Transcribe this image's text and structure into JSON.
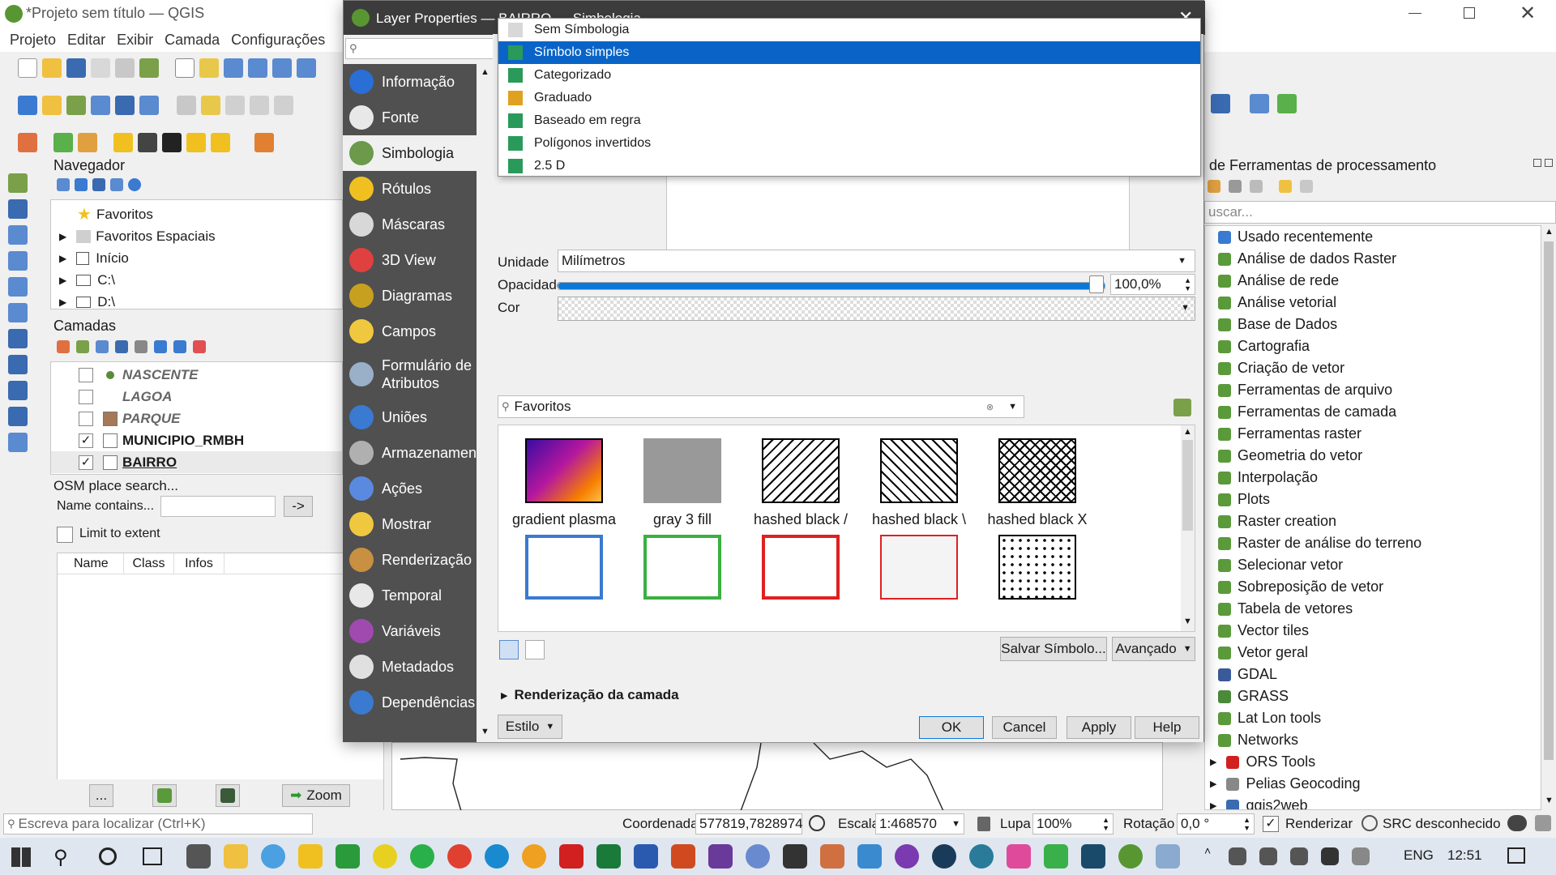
{
  "app": {
    "title": "*Projeto sem título — QGIS"
  },
  "menu": [
    "Projeto",
    "Editar",
    "Exibir",
    "Camada",
    "Configurações"
  ],
  "browser": {
    "title": "Navegador",
    "items": [
      {
        "label": "Favoritos"
      },
      {
        "label": "Favoritos Espaciais"
      },
      {
        "label": "Início"
      },
      {
        "label": "C:\\"
      },
      {
        "label": "D:\\"
      }
    ]
  },
  "layers": {
    "title": "Camadas",
    "items": [
      {
        "name": "NASCENTE",
        "checked": false,
        "bold": false,
        "italic": true,
        "swatch": "#5a8a3a"
      },
      {
        "name": "LAGOA",
        "checked": false,
        "bold": false,
        "italic": true,
        "swatch": "#ffffff"
      },
      {
        "name": "PARQUE",
        "checked": false,
        "bold": false,
        "italic": true,
        "swatch": "#a57858"
      },
      {
        "name": "MUNICIPIO_RMBH",
        "checked": true,
        "bold": true,
        "italic": false,
        "swatch": "#ffffff"
      },
      {
        "name": "BAIRRO",
        "checked": true,
        "bold": true,
        "italic": false,
        "swatch": "#ffffff",
        "underline": true
      }
    ]
  },
  "osm": {
    "title": "OSM place search...",
    "name_label": "Name contains...",
    "go": "->",
    "limit": "Limit to extent",
    "columns": [
      "Name",
      "Class",
      "Infos"
    ],
    "zoom": "Zoom",
    "dots": "..."
  },
  "dialog": {
    "title": "Layer Properties — BAIRRO — Simbologia",
    "sidebar": [
      "Informação",
      "Fonte",
      "Simbologia",
      "Rótulos",
      "Máscaras",
      "3D View",
      "Diagramas",
      "Campos",
      "Formulário de Atributos",
      "Uniões",
      "Armazenamento",
      "Ações",
      "Mostrar",
      "Renderização",
      "Temporal",
      "Variáveis",
      "Metadados",
      "Dependências"
    ],
    "sidebar_colors": [
      "#2a6fd6",
      "#e8e8e8",
      "#6a9a4a",
      "#f0c020",
      "#d8d8d8",
      "#e04040",
      "#c8a020",
      "#f0c840",
      "#9ab0c8",
      "#3a7ad0",
      "#b0b0b0",
      "#5a8ae0",
      "#f0c840",
      "#c89040",
      "#e8e8e8",
      "#a04ab0",
      "#e0e0e0",
      "#3a7ad0"
    ],
    "selected": "Simbologia",
    "dropdown": [
      {
        "label": "Sem Símbologia",
        "color": "#d8d8d8"
      },
      {
        "label": "Símbolo simples",
        "color": "#2a9a5a"
      },
      {
        "label": "Categorizado",
        "color": "#2a9a5a"
      },
      {
        "label": "Graduado",
        "color": "#e0a020"
      },
      {
        "label": "Baseado em regra",
        "color": "#2a9a5a"
      },
      {
        "label": "Polígonos invertidos",
        "color": "#2a9a5a"
      },
      {
        "label": "2.5 D",
        "color": "#2a9a5a"
      }
    ],
    "dropdown_selected": "Símbolo simples",
    "unit_label": "Unidade",
    "unit_value": "Milímetros",
    "opacity_label": "Opacidade",
    "opacity_value": "100,0%",
    "opacity_fill": 1.0,
    "color_label": "Cor",
    "search_value": "Favoritos",
    "symbols": [
      {
        "label": "gradient plasma"
      },
      {
        "label": "gray 3 fill"
      },
      {
        "label": "hashed black /"
      },
      {
        "label": "hashed black \\"
      },
      {
        "label": "hashed black X"
      }
    ],
    "save_symbol": "Salvar Símbolo...",
    "advanced": "Avançado",
    "rendering": "Renderização da camada",
    "style": "Estilo",
    "ok": "OK",
    "cancel": "Cancel",
    "apply": "Apply",
    "help": "Help"
  },
  "processing": {
    "title": "de Ferramentas de processamento",
    "search_placeholder": "uscar...",
    "items": [
      "Usado recentemente",
      "Análise de dados Raster",
      "Análise de rede",
      "Análise vetorial",
      "Base de Dados",
      "Cartografia",
      "Criação de vetor",
      "Ferramentas de arquivo",
      "Ferramentas de camada",
      "Ferramentas raster",
      "Geometria do vetor",
      "Interpolação",
      "Plots",
      "Raster creation",
      "Raster de análise do terreno",
      "Selecionar vetor",
      "Sobreposição de vetor",
      "Tabela de vetores",
      "Vector tiles",
      "Vetor geral",
      "GDAL",
      "GRASS",
      "Lat Lon tools",
      "Networks",
      "ORS Tools",
      "Pelias Geocoding",
      "qgis2web"
    ]
  },
  "status": {
    "locator_placeholder": "Escreva para localizar (Ctrl+K)",
    "coord_label": "Coordenada",
    "coord_value": "577819,7828974",
    "scale_label": "Escala",
    "scale_value": "1:468570",
    "magnifier_label": "Lupa",
    "magnifier_value": "100%",
    "rotation_label": "Rotação",
    "rotation_value": "0,0 °",
    "render_label": "Renderizar",
    "crs": "SRC desconhecido"
  },
  "taskbar": {
    "lang": "ENG",
    "time": "12:51"
  }
}
